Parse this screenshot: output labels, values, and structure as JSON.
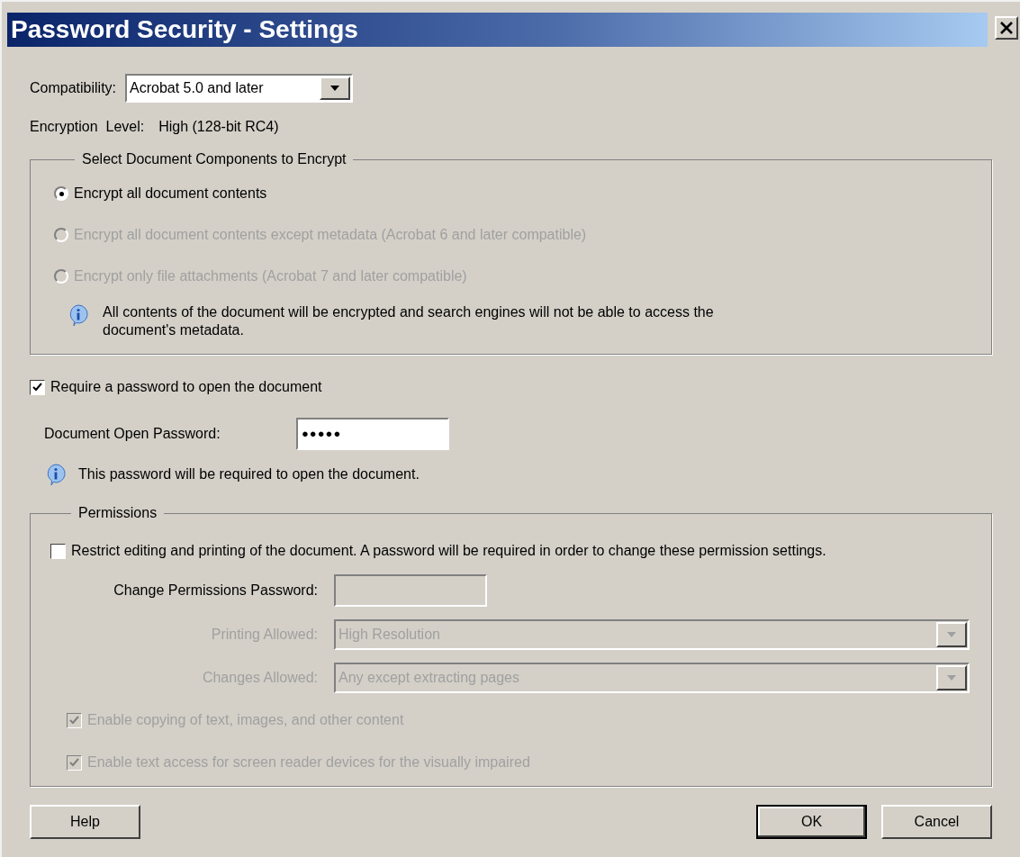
{
  "window": {
    "title": "Password Security - Settings"
  },
  "compatibility": {
    "label": "Compatibility:",
    "value": "Acrobat 5.0 and later"
  },
  "encryption_level": {
    "label": "Encryption  Level:",
    "value": "High (128-bit RC4)"
  },
  "components": {
    "title": "Select Document Components to Encrypt",
    "options": [
      {
        "label": "Encrypt all document contents",
        "selected": true,
        "disabled": false
      },
      {
        "label": "Encrypt all document contents except metadata (Acrobat 6 and later compatible)",
        "selected": false,
        "disabled": true
      },
      {
        "label": "Encrypt only file attachments (Acrobat 7 and later compatible)",
        "selected": false,
        "disabled": true
      }
    ],
    "info": "All contents of the document will be encrypted and search engines will not be able to access the document's metadata."
  },
  "require_password": {
    "label": "Require a password to open the document",
    "checked": true
  },
  "open_password": {
    "label": "Document Open Password:",
    "value": "●●●●●"
  },
  "password_info": "This password will be required to open the document.",
  "permissions": {
    "title": "Permissions",
    "restrict": {
      "label": "Restrict editing and printing of the document. A password will be required in order to change these permission settings.",
      "checked": false
    },
    "change_password": {
      "label": "Change Permissions Password:",
      "disabled": true
    },
    "selects": [
      {
        "label": "Printing Allowed:",
        "value": "High Resolution",
        "disabled": true
      },
      {
        "label": "Changes Allowed:",
        "value": "Any except extracting pages",
        "disabled": true
      }
    ],
    "options": [
      {
        "label": "Enable copying of text, images, and other content",
        "checked": true,
        "disabled": true
      },
      {
        "label": "Enable text access for screen reader devices for the visually impaired",
        "checked": true,
        "disabled": true
      }
    ]
  },
  "buttons": [
    {
      "label": "Help",
      "kind": "help",
      "default": false
    },
    {
      "label": "OK",
      "kind": "action",
      "default": true
    },
    {
      "label": "Cancel",
      "kind": "action",
      "default": false
    }
  ]
}
